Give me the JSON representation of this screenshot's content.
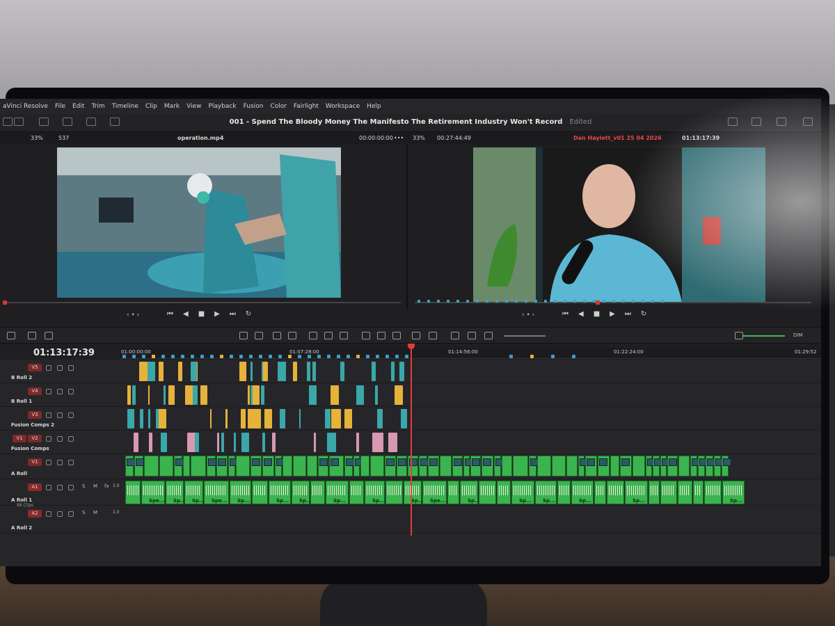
{
  "app": {
    "name": "aVinci Resolve"
  },
  "menu": [
    "File",
    "Edit",
    "Trim",
    "Timeline",
    "Clip",
    "Mark",
    "View",
    "Playback",
    "Fusion",
    "Color",
    "Fairlight",
    "Workspace",
    "Help"
  ],
  "project": {
    "title": "001 - Spend The Bloody Money The Manifesto The Retirement Industry Won't Record",
    "status": "Edited"
  },
  "source_viewer": {
    "zoom": "33%",
    "frame": "537",
    "clip_name": "operation.mp4",
    "timecode": "00:00:00:00",
    "dots": "•••"
  },
  "record_viewer": {
    "zoom": "33%",
    "duration": "00:27:44:49",
    "timeline_name": "Dan Haylett_v01 25 04 2026",
    "timecode": "01:13:17:39"
  },
  "transport": {
    "jog": "‹ • ›",
    "prev": "⏮",
    "back": "◀",
    "stop": "■",
    "play": "▶",
    "next": "⏭",
    "loop": "↻"
  },
  "timeline": {
    "timecode": "01:13:17:39",
    "ruler": [
      "01:00:00:00",
      "01:07:28:00",
      "01:14:56:00",
      "01:22:24:00",
      "01:29:52"
    ],
    "volume_label": "DIM",
    "tracks": [
      {
        "id": "V5",
        "name": "B Roll 2"
      },
      {
        "id": "V4",
        "name": "B Roll 1"
      },
      {
        "id": "V3",
        "name": "Fusion Comps 2"
      },
      {
        "id": "V2",
        "name": "Fusion Comps"
      },
      {
        "id": "V1",
        "name": "A Roll"
      },
      {
        "id": "A1",
        "name": "A Roll 1",
        "sub": "88 Clips",
        "level": "1.0"
      },
      {
        "id": "A2",
        "name": "A Roll 2",
        "level": "1.0"
      }
    ],
    "v1_extra": "V1",
    "clip_label": "Spe...",
    "clip_label_short": "Sp...",
    "solo": "S",
    "mute": "M",
    "fx": "fx"
  },
  "colors": {
    "accent_red": "#e23b3b",
    "clip_green": "#3bb44f",
    "marker_blue": "#3aa0cc",
    "fusion_pink": "#d899b0",
    "clip_yellow": "#e7b23a",
    "clip_teal": "#3aa7a8"
  }
}
